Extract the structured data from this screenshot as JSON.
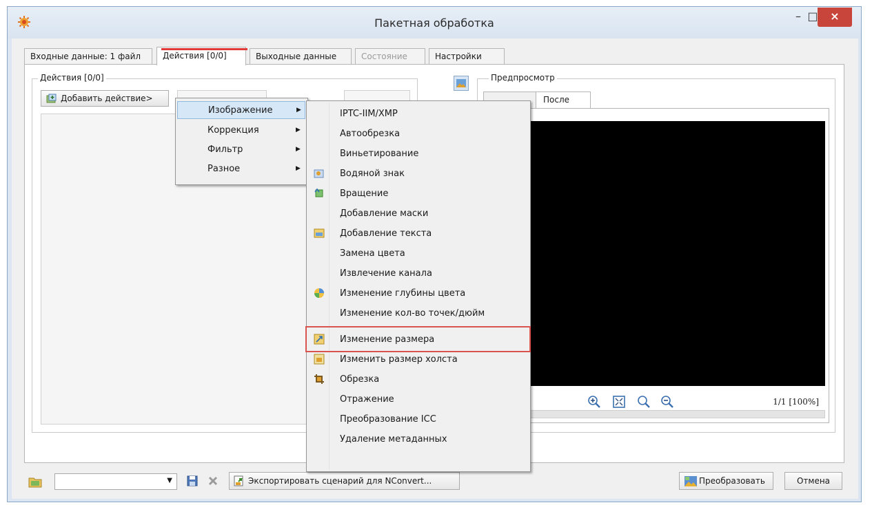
{
  "window": {
    "title": "Пакетная обработка",
    "minimize_glyph": "–",
    "maximize_glyph": "□",
    "close_glyph": "×"
  },
  "tabs": [
    {
      "label": "Входные данные: 1 файл",
      "state": "normal"
    },
    {
      "label": "Действия [0/0]",
      "state": "active"
    },
    {
      "label": "Выходные данные",
      "state": "normal"
    },
    {
      "label": "Состояние",
      "state": "disabled"
    },
    {
      "label": "Настройки",
      "state": "normal"
    }
  ],
  "actions_group": {
    "label": "Действия [0/0]",
    "add_button": "Добавить действие>"
  },
  "preview_group": {
    "label": "Предпросмотр",
    "tab_after": "После",
    "status": "1/1 [100%]"
  },
  "submenu_main": {
    "items": [
      {
        "label": "Изображение",
        "highlighted": true
      },
      {
        "label": "Коррекция",
        "highlighted": false
      },
      {
        "label": "Фильтр",
        "highlighted": false
      },
      {
        "label": "Разное",
        "highlighted": false
      }
    ],
    "arrow": "▶"
  },
  "submenu_image": {
    "items": [
      {
        "label": "IPTC-IIM/XMP",
        "icon": null
      },
      {
        "label": "Автообрезка",
        "icon": null
      },
      {
        "label": "Виньетирование",
        "icon": null
      },
      {
        "label": "Водяной знак",
        "icon": "watermark-icon"
      },
      {
        "label": "Вращение",
        "icon": "rotate-icon"
      },
      {
        "label": "Добавление маски",
        "icon": null
      },
      {
        "label": "Добавление текста",
        "icon": "text-icon"
      },
      {
        "label": "Замена цвета",
        "icon": null
      },
      {
        "label": "Извлечение канала",
        "icon": null
      },
      {
        "label": "Изменение глубины цвета",
        "icon": "color-depth-icon"
      },
      {
        "label": "Изменение кол-во точек/дюйм",
        "icon": null
      },
      {
        "label": "Изменение размера",
        "icon": "resize-icon",
        "highlighted": true
      },
      {
        "label": "Изменить размер холста",
        "icon": "canvas-icon"
      },
      {
        "label": "Обрезка",
        "icon": "crop-icon"
      },
      {
        "label": "Отражение",
        "icon": null
      },
      {
        "label": "Преобразование ICC",
        "icon": null
      },
      {
        "label": "Удаление метаданных",
        "icon": null
      }
    ]
  },
  "bottom_bar": {
    "export_button": "Экспортировать сценарий для NConvert...",
    "convert_button": "Преобразовать",
    "cancel_button": "Отмена",
    "combo_arrow": "▼"
  },
  "colors": {
    "accent_red": "#d9534f",
    "close_button": "#c7453a",
    "highlight": "#d6e7f8"
  }
}
